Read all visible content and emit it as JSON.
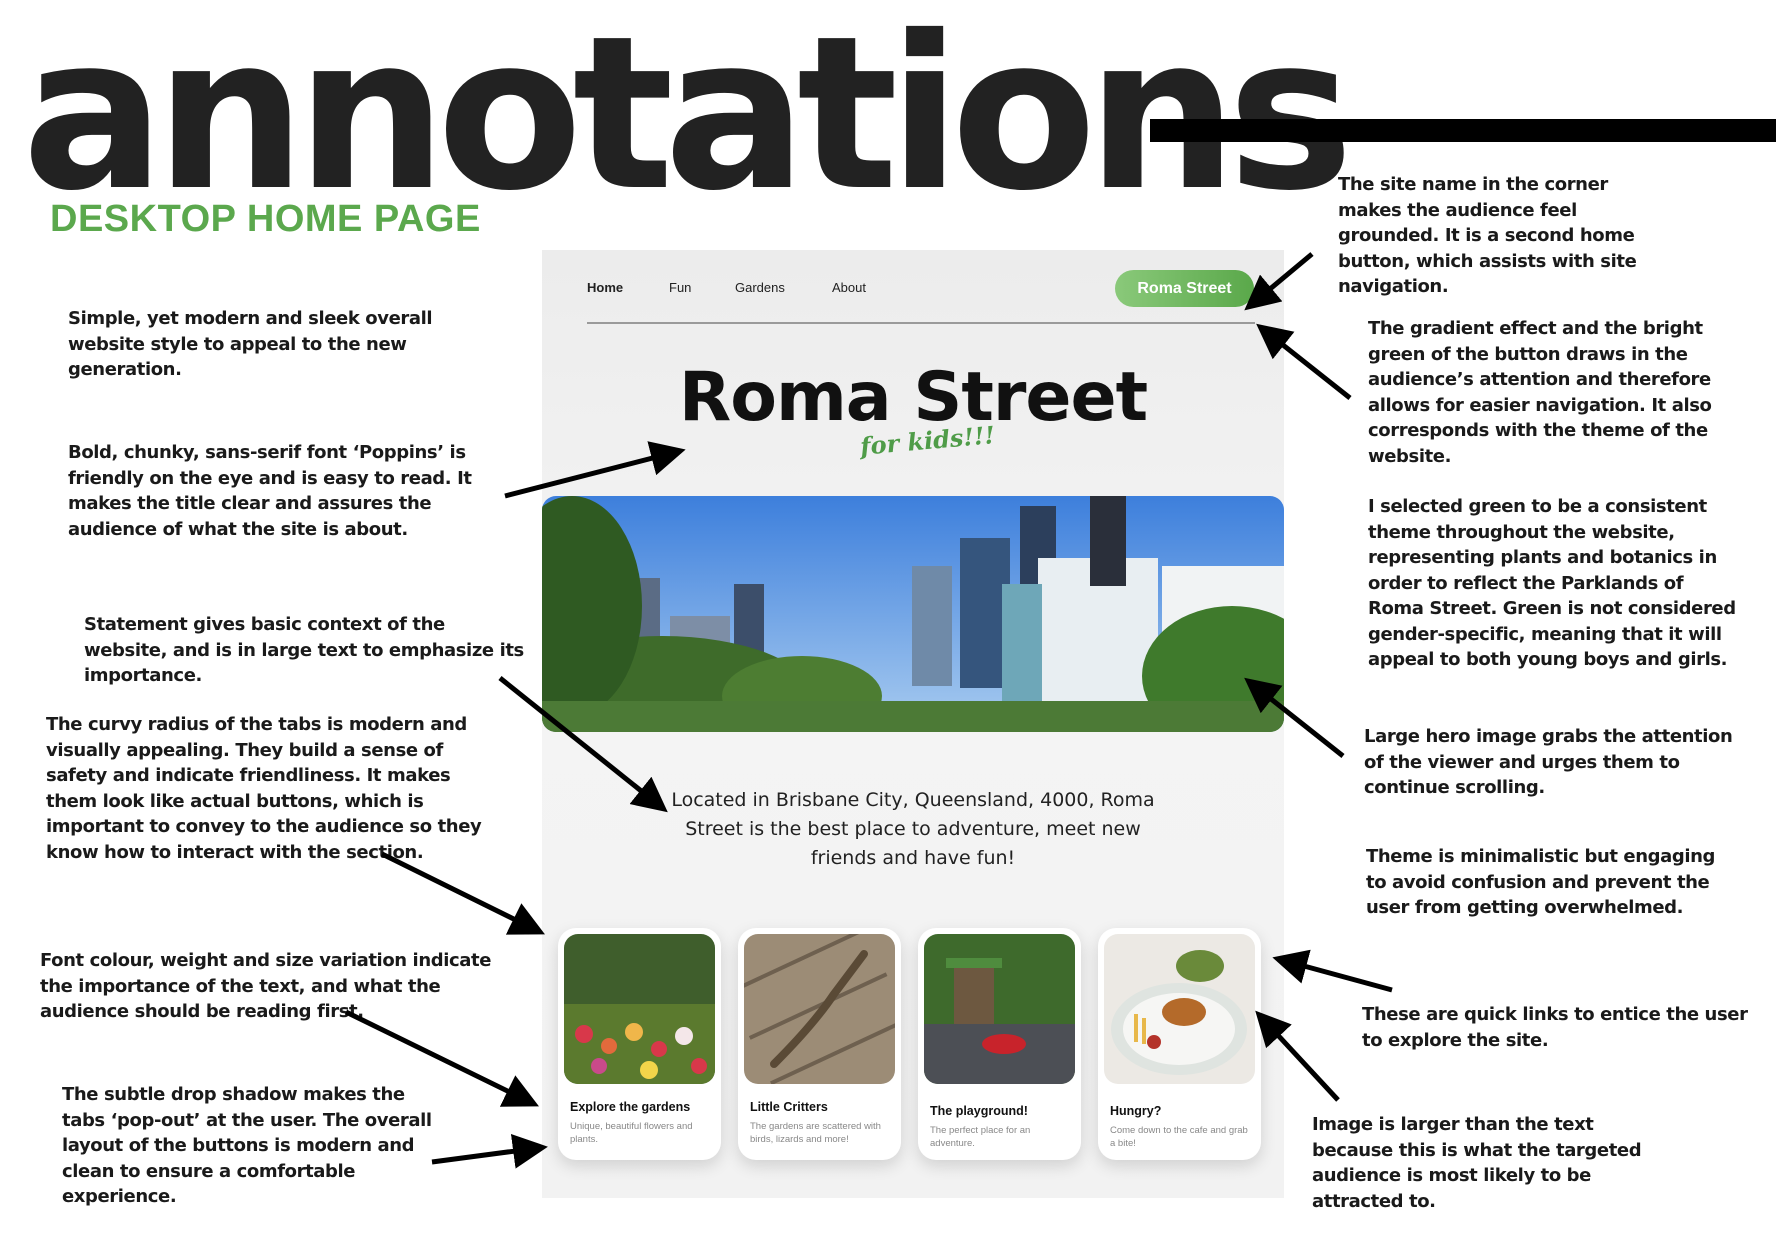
{
  "header": {
    "title": "annotations",
    "subtitle": "DESKTOP HOME PAGE"
  },
  "annotations": {
    "left": [
      "Simple, yet modern and sleek overall website style to appeal to the new generation.",
      "Bold, chunky, sans-serif font ‘Poppins’ is friendly on the eye and is easy to read. It makes the title clear and assures the audience of what the site is about.",
      "Statement gives basic context of the website, and is in large text to emphasize its importance.",
      "The curvy radius of the tabs is modern and visually appealing. They build a sense of safety and indicate friendliness.  It makes them look like actual buttons, which is important to convey to the audience so they know how to interact with the section.",
      "Font colour, weight and size variation indicate the importance of the text, and what the audience should be reading first.",
      "The subtle drop shadow makes the tabs ‘pop-out’ at the user. The overall layout of the buttons is modern and clean to ensure a comfortable experience."
    ],
    "right": [
      "The site name in the corner makes the audience feel grounded. It is a second home button, which assists with site navigation.",
      "The gradient effect and the bright green of the button draws in the audience’s attention and therefore allows for easier navigation. It also corresponds with the theme of the website.",
      "I selected green to be a consistent theme throughout the website, representing plants and botanics in order to reflect the Parklands of Roma Street. Green is not considered gender-specific, meaning that it will appeal to both young boys and girls.",
      "Large hero image grabs the attention of the viewer and urges them to continue scrolling.",
      "Theme is minimalistic but engaging to avoid confusion and prevent the user from getting overwhelmed.",
      "These are quick links to entice the user to explore the site.",
      "Image is larger than the text because this is what the targeted audience is most likely to be attracted to."
    ]
  },
  "mockup": {
    "nav": {
      "home": "Home",
      "fun": "Fun",
      "gardens": "Gardens",
      "about": "About",
      "brand_button": "Roma Street"
    },
    "hero": {
      "title": "Roma Street",
      "tagline": "for kids!!!"
    },
    "intro": "Located in Brisbane City, Queensland, 4000, Roma Street is the best place to adventure, meet new friends and have fun!",
    "cards": [
      {
        "title": "Explore the gardens",
        "desc": "Unique, beautiful flowers and plants."
      },
      {
        "title": "Little Critters",
        "desc": "The gardens are scattered with birds, lizards and more!"
      },
      {
        "title": "The playground!",
        "desc": "The perfect place for an adventure."
      },
      {
        "title": "Hungry?",
        "desc": "Come down to the cafe and grab a bite!"
      }
    ],
    "brand_color": "#5ba84d"
  }
}
